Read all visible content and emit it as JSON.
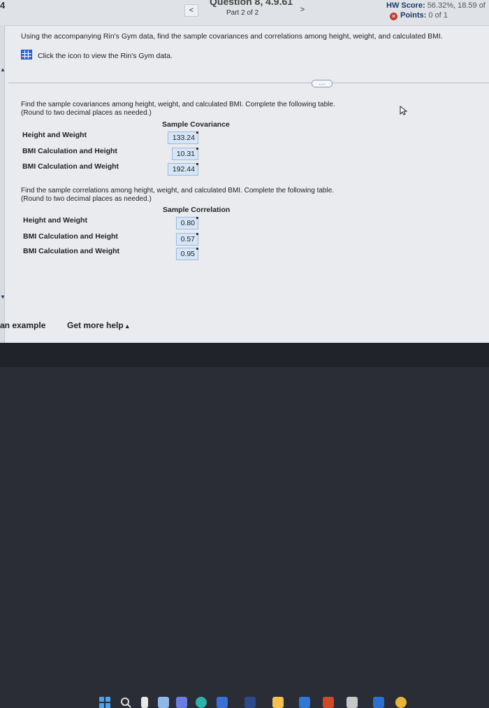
{
  "header": {
    "question_number": "4",
    "question_title": "Question 8, 4.9.61",
    "part": "Part 2 of 2",
    "prev_glyph": "<",
    "next_glyph": ">",
    "hw_score_label": "HW Score:",
    "hw_score_value": "56.32%, 18.59 of",
    "points_label": "Points:",
    "points_value": "0 of 1"
  },
  "prompt": {
    "text": "Using the accompanying Rin's Gym data, find the sample covariances and correlations among height, weight, and calculated BMI.",
    "data_link": "Click the icon to view the Rin's Gym data."
  },
  "more_button": "....",
  "covariance": {
    "instruction_line1": "Find the sample covariances among height, weight, and calculated BMI. Complete the following table.",
    "instruction_line2": "(Round to two decimal places as needed.)",
    "column_header": "Sample Covariance",
    "rows": [
      {
        "label": "Height and Weight",
        "value": "133.24"
      },
      {
        "label": "BMI Calculation and Height",
        "value": "10.31"
      },
      {
        "label": "BMI Calculation and Weight",
        "value": "192.44"
      }
    ]
  },
  "correlation": {
    "instruction_line1": "Find the sample correlations among height, weight, and calculated BMI. Complete the following table.",
    "instruction_line2": "(Round to two decimal places as needed.)",
    "column_header": "Sample Correlation",
    "rows": [
      {
        "label": "Height and Weight",
        "value": "0.80"
      },
      {
        "label": "BMI Calculation and Height",
        "value": "0.57"
      },
      {
        "label": "BMI Calculation and Weight",
        "value": "0.95"
      }
    ]
  },
  "footer": {
    "example": "an example",
    "help": "Get more help",
    "help_arrow": "▴"
  },
  "colors": {
    "accent": "#1b3a6b",
    "input_fill": "#d6e6f7",
    "incorrect": "#c0392b"
  }
}
